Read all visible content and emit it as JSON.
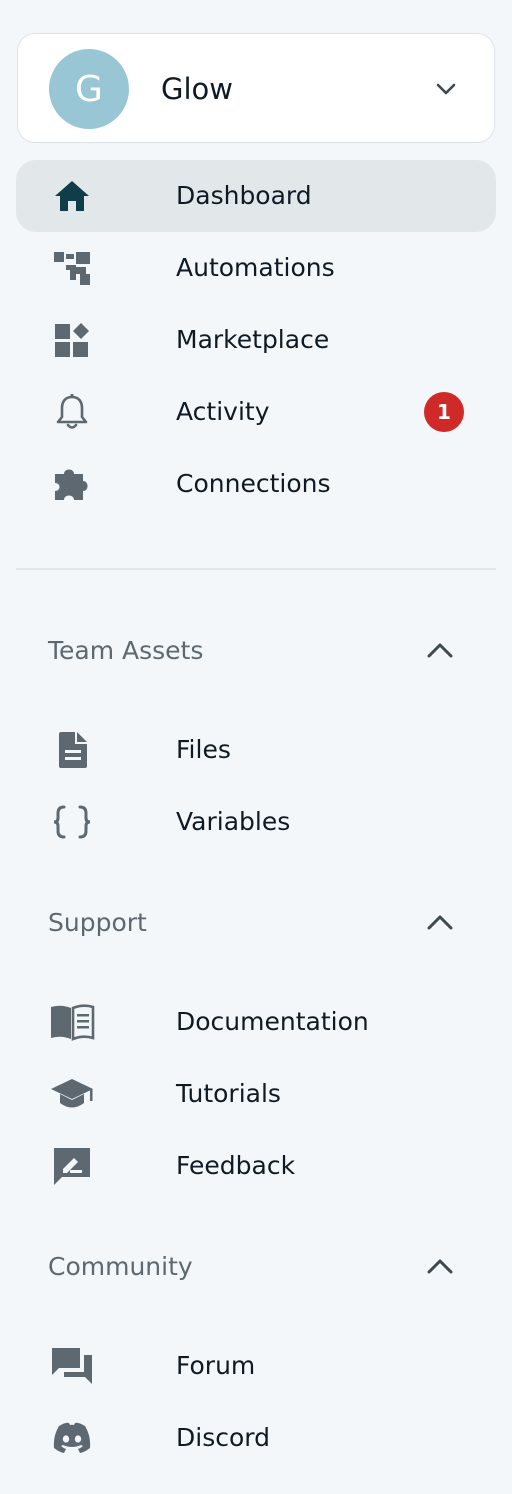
{
  "workspace": {
    "initial": "G",
    "name": "Glow",
    "avatar_color": "#98c6d5"
  },
  "nav": {
    "items": [
      {
        "label": "Dashboard",
        "icon": "home-icon",
        "active": true
      },
      {
        "label": "Automations",
        "icon": "flow-icon"
      },
      {
        "label": "Marketplace",
        "icon": "widgets-icon"
      },
      {
        "label": "Activity",
        "icon": "bell-icon",
        "badge": "1"
      },
      {
        "label": "Connections",
        "icon": "puzzle-icon"
      }
    ]
  },
  "sections": [
    {
      "title": "Team Assets",
      "expanded": true,
      "items": [
        {
          "label": "Files",
          "icon": "file-icon"
        },
        {
          "label": "Variables",
          "icon": "braces-icon"
        }
      ]
    },
    {
      "title": "Support",
      "expanded": true,
      "items": [
        {
          "label": "Documentation",
          "icon": "book-icon"
        },
        {
          "label": "Tutorials",
          "icon": "graduation-cap-icon"
        },
        {
          "label": "Feedback",
          "icon": "feedback-icon"
        }
      ]
    },
    {
      "title": "Community",
      "expanded": true,
      "items": [
        {
          "label": "Forum",
          "icon": "forum-icon"
        },
        {
          "label": "Discord",
          "icon": "discord-icon"
        }
      ]
    }
  ],
  "colors": {
    "background": "#f4f7f9",
    "active_bg": "#e2e7ea",
    "active_icon": "#0f3d4a",
    "icon": "#5d6870",
    "badge": "#cf2a27"
  }
}
